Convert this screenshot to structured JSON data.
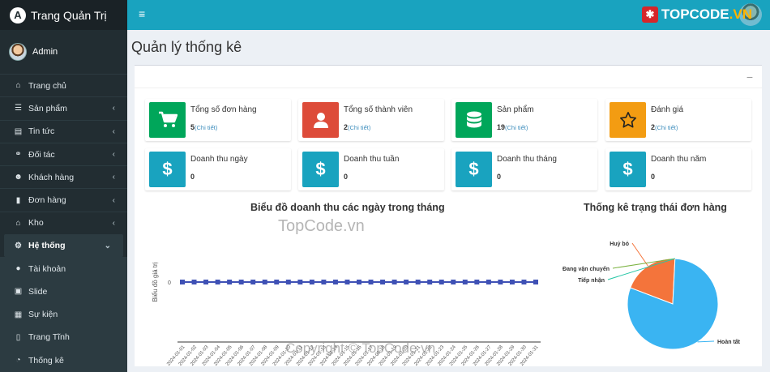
{
  "brand": {
    "logo_letter": "A",
    "title": "Trang Quản Trị"
  },
  "user": {
    "name": "Admin"
  },
  "sidebar": {
    "items": [
      {
        "label": "Trang chủ",
        "icon": "home-icon",
        "glyph": "⌂",
        "chevron": ""
      },
      {
        "label": "Sản phẩm",
        "icon": "database-icon",
        "glyph": "☰",
        "chevron": "‹"
      },
      {
        "label": "Tin tức",
        "icon": "newspaper-icon",
        "glyph": "▤",
        "chevron": "‹"
      },
      {
        "label": "Đối tác",
        "icon": "handshake-icon",
        "glyph": "⚭",
        "chevron": "‹"
      },
      {
        "label": "Khách hàng",
        "icon": "users-icon",
        "glyph": "☻",
        "chevron": "‹"
      },
      {
        "label": "Đơn hàng",
        "icon": "file-icon",
        "glyph": "▮",
        "chevron": "‹"
      },
      {
        "label": "Kho",
        "icon": "warehouse-icon",
        "glyph": "⌂",
        "chevron": "‹"
      },
      {
        "label": "Hệ thống",
        "icon": "cogs-icon",
        "glyph": "⚙",
        "chevron": "⌄"
      },
      {
        "label": "Tài khoản",
        "icon": "user-circle-icon",
        "glyph": "●",
        "chevron": ""
      },
      {
        "label": "Slide",
        "icon": "images-icon",
        "glyph": "▣",
        "chevron": ""
      },
      {
        "label": "Sự kiện",
        "icon": "film-icon",
        "glyph": "▦",
        "chevron": ""
      },
      {
        "label": "Trang Tĩnh",
        "icon": "file-alt-icon",
        "glyph": "▯",
        "chevron": ""
      },
      {
        "label": "Thống kê",
        "icon": "pie-chart-icon",
        "glyph": "◔",
        "chevron": ""
      }
    ]
  },
  "header": {
    "menu_glyph": "≡",
    "logo_a": "TOPCODE",
    "logo_b": ".VN",
    "logo_mark": "✱"
  },
  "page": {
    "title": "Quản lý thống kê",
    "collapse_glyph": "−"
  },
  "stats_row1": [
    {
      "title": "Tổng số đơn hàng",
      "value": "5",
      "link": "(Chi tiết)",
      "color": "#00a65a",
      "icon": "cart-icon"
    },
    {
      "title": "Tổng số thành viên",
      "value": "2",
      "link": "(Chi tiết)",
      "color": "#dd4b39",
      "icon": "user-icon"
    },
    {
      "title": "Sản phẩm",
      "value": "19",
      "link": "(Chi tiết)",
      "color": "#00a65a",
      "icon": "database-icon"
    },
    {
      "title": "Đánh giá",
      "value": "2",
      "link": "(Chi tiết)",
      "color": "#f39c12",
      "icon": "star-icon"
    }
  ],
  "stats_row2": [
    {
      "title": "Doanh thu ngày",
      "value": "0",
      "color": "#19a3bf",
      "icon": "dollar-icon"
    },
    {
      "title": "Doanh thu tuần",
      "value": "0",
      "color": "#19a3bf",
      "icon": "dollar-icon"
    },
    {
      "title": "Doanh thu tháng",
      "value": "0",
      "color": "#19a3bf",
      "icon": "dollar-icon"
    },
    {
      "title": "Doanh thu năm",
      "value": "0",
      "color": "#19a3bf",
      "icon": "dollar-icon"
    }
  ],
  "watermarks": {
    "center": "TopCode.vn",
    "bottom": "Copyright © TopCode.vn"
  },
  "chart_data": [
    {
      "type": "line",
      "title": "Biểu đồ doanh thu các ngày trong tháng",
      "ylabel": "Biểu đồ giá trị",
      "y_tick": "0",
      "color": "#3f51b5",
      "x": [
        "2024-01-01",
        "2024-01-02",
        "2024-01-03",
        "2024-01-04",
        "2024-01-05",
        "2024-01-06",
        "2024-01-07",
        "2024-01-08",
        "2024-01-09",
        "2024-01-10",
        "2024-01-11",
        "2024-01-12",
        "2024-01-13",
        "2024-01-14",
        "2024-01-15",
        "2024-01-16",
        "2024-01-17",
        "2024-01-18",
        "2024-01-19",
        "2024-01-20",
        "2024-01-21",
        "2024-01-22",
        "2024-01-23",
        "2024-01-24",
        "2024-01-25",
        "2024-01-26",
        "2024-01-27",
        "2024-01-28",
        "2024-01-29",
        "2024-01-30",
        "2024-01-31"
      ],
      "values": [
        0,
        0,
        0,
        0,
        0,
        0,
        0,
        0,
        0,
        0,
        0,
        0,
        0,
        0,
        0,
        0,
        0,
        0,
        0,
        0,
        0,
        0,
        0,
        0,
        0,
        0,
        0,
        0,
        0,
        0,
        0
      ]
    },
    {
      "type": "pie",
      "title": "Thống kê trạng thái đơn hàng",
      "slices": [
        {
          "label": "Hoàn tất",
          "value": 80,
          "color": "#3ab4f2"
        },
        {
          "label": "Huỷ bỏ",
          "value": 20,
          "color": "#f4743b"
        },
        {
          "label": "Đang vận chuyển",
          "value": 0,
          "color": "#7cb342"
        },
        {
          "label": "Tiếp nhận",
          "value": 0,
          "color": "#26c6a6"
        }
      ]
    }
  ]
}
